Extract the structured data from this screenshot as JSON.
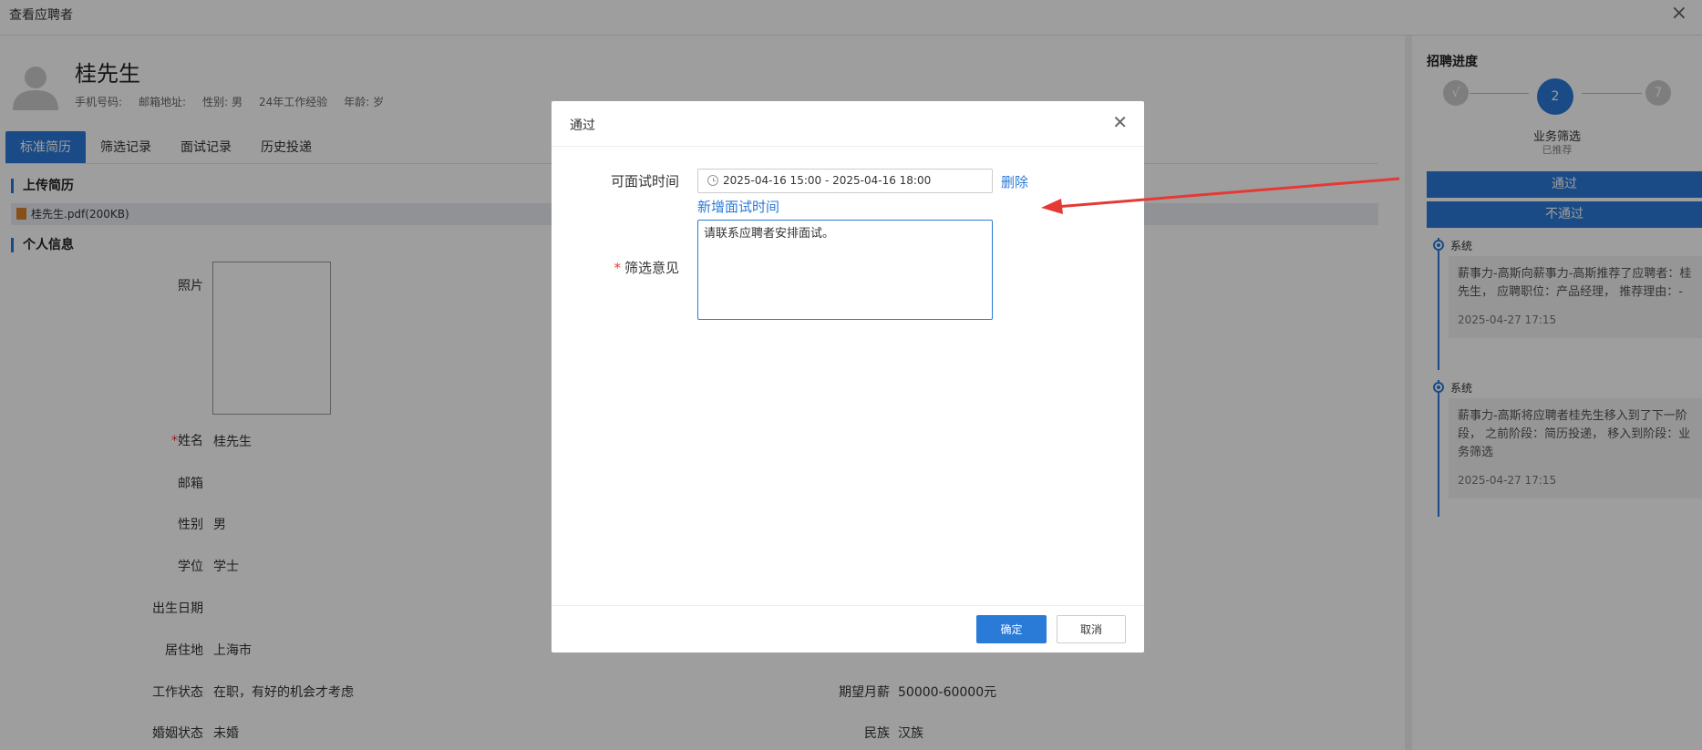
{
  "window": {
    "title": "查看应聘者",
    "close_icon": "×"
  },
  "candidate": {
    "name": "桂先生",
    "meta": [
      "手机号码:",
      "邮箱地址:",
      "性别: 男",
      "24年工作经验",
      "年龄: 岁"
    ]
  },
  "tabs": [
    "标准简历",
    "筛选记录",
    "面试记录",
    "历史投递"
  ],
  "resume": {
    "upload_heading": "上传简历",
    "file_name": "桂先生.pdf(200KB)",
    "personal_heading": "个人信息",
    "fields": {
      "photo": "照片",
      "name_label": "姓名",
      "name_value": "桂先生",
      "email_label": "邮箱",
      "gender_label": "性别",
      "gender_value": "男",
      "degree_label": "学位",
      "degree_value": "学士",
      "birth_label": "出生日期",
      "residence_label": "居住地",
      "residence_value": "上海市",
      "work_status_label": "工作状态",
      "work_status_value": "在职，有好的机会才考虑",
      "marital_label": "婚姻状态",
      "marital_value": "未婚",
      "salary_label": "期望月薪",
      "salary_value": "50000-60000元",
      "ethnicity_label": "民族",
      "ethnicity_value": "汉族"
    }
  },
  "progress": {
    "title": "招聘进度",
    "steps": [
      {
        "label": "√"
      },
      {
        "label": "2"
      },
      {
        "label": "7"
      }
    ],
    "current_stage": "业务筛选",
    "current_status": "已推荐",
    "pass_button": "通过",
    "reject_button": "不通过",
    "timeline": [
      {
        "who": "系统",
        "text": "薪事力-高斯向薪事力-高斯推荐了应聘者：桂先生， 应聘职位：产品经理， 推荐理由：-",
        "time": "2025-04-27 17:15"
      },
      {
        "who": "系统",
        "text": "薪事力-高斯将应聘者桂先生移入到了下一阶段， 之前阶段：简历投递， 移入到阶段：业务筛选",
        "time": "2025-04-27 17:15"
      }
    ]
  },
  "modal": {
    "title": "通过",
    "interview_time_label": "可面试时间",
    "interview_time_value": "2025-04-16 15:00 - 2025-04-16 18:00",
    "delete_link": "删除",
    "add_time_link": "新增面试时间",
    "opinion_label": "筛选意见",
    "opinion_value": "请联系应聘者安排面试。",
    "ok_button": "确定",
    "cancel_button": "取消"
  },
  "colors": {
    "accent": "#2a7ad8",
    "annotation_arrow": "#e53935"
  }
}
